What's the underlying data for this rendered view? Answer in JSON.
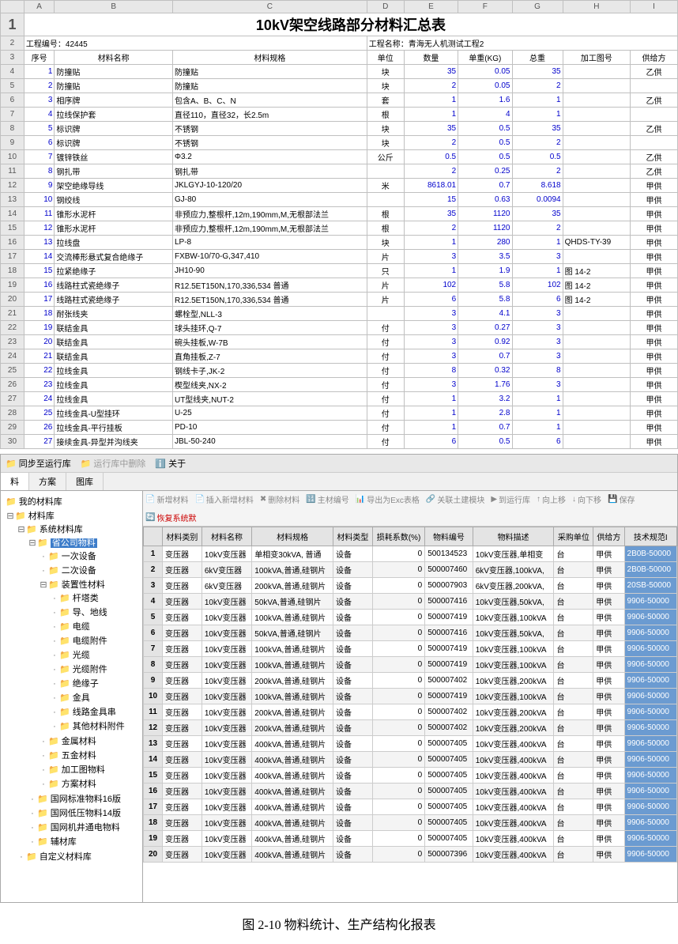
{
  "sheet": {
    "title": "10kV架空线路部分材料汇总表",
    "columns": [
      "A",
      "B",
      "C",
      "D",
      "E",
      "F",
      "G",
      "H",
      "I"
    ],
    "project_no_label": "工程编号：",
    "project_no": "42445",
    "project_name_label": "工程名称：",
    "project_name": "青海无人机测试工程2",
    "headers": [
      "序号",
      "材料名称",
      "材料规格",
      "单位",
      "数量",
      "单重(KG)",
      "总重",
      "加工图号",
      "供给方"
    ],
    "rows": [
      {
        "n": 1,
        "name": "防撞贴",
        "spec": "防撞贴",
        "unit": "块",
        "qty": "35",
        "uw": "0.05",
        "tw": "35",
        "fig": "",
        "sup": "乙供"
      },
      {
        "n": 2,
        "name": "防撞贴",
        "spec": "防撞贴",
        "unit": "块",
        "qty": "2",
        "uw": "0.05",
        "tw": "2",
        "fig": "",
        "sup": ""
      },
      {
        "n": 3,
        "name": "相序牌",
        "spec": "包含A、B、C、N",
        "unit": "套",
        "qty": "1",
        "uw": "1.6",
        "tw": "1",
        "fig": "",
        "sup": "乙供"
      },
      {
        "n": 4,
        "name": "拉线保护套",
        "spec": "直径110，直径32，长2.5m",
        "unit": "根",
        "qty": "1",
        "uw": "4",
        "tw": "1",
        "fig": "",
        "sup": ""
      },
      {
        "n": 5,
        "name": "标识牌",
        "spec": "不锈钢",
        "unit": "块",
        "qty": "35",
        "uw": "0.5",
        "tw": "35",
        "fig": "",
        "sup": "乙供"
      },
      {
        "n": 6,
        "name": "标识牌",
        "spec": "不锈钢",
        "unit": "块",
        "qty": "2",
        "uw": "0.5",
        "tw": "2",
        "fig": "",
        "sup": ""
      },
      {
        "n": 7,
        "name": "镀锌铁丝",
        "spec": "Φ3.2",
        "unit": "公斤",
        "qty": "0.5",
        "uw": "0.5",
        "tw": "0.5",
        "fig": "",
        "sup": "乙供"
      },
      {
        "n": 8,
        "name": "钢扎带",
        "spec": "钢扎带",
        "unit": "",
        "qty": "2",
        "uw": "0.25",
        "tw": "2",
        "fig": "",
        "sup": "乙供"
      },
      {
        "n": 9,
        "name": "架空绝缘导线",
        "spec": "JKLGYJ-10-120/20",
        "unit": "米",
        "qty": "8618.01",
        "uw": "0.7",
        "tw": "8.618",
        "fig": "",
        "sup": "甲供"
      },
      {
        "n": 10,
        "name": "钢绞线",
        "spec": "GJ-80",
        "unit": "",
        "qty": "15",
        "uw": "0.63",
        "tw": "0.0094",
        "fig": "",
        "sup": "甲供"
      },
      {
        "n": 11,
        "name": "锥形水泥杆",
        "spec": "非预应力,整根杆,12m,190mm,M,无根部法兰",
        "unit": "根",
        "qty": "35",
        "uw": "1120",
        "tw": "35",
        "fig": "",
        "sup": "甲供"
      },
      {
        "n": 12,
        "name": "锥形水泥杆",
        "spec": "非预应力,整根杆,12m,190mm,M,无根部法兰",
        "unit": "根",
        "qty": "2",
        "uw": "1120",
        "tw": "2",
        "fig": "",
        "sup": "甲供"
      },
      {
        "n": 13,
        "name": "拉线盘",
        "spec": "LP-8",
        "unit": "块",
        "qty": "1",
        "uw": "280",
        "tw": "1",
        "fig": "QHDS-TY-39",
        "sup": "甲供"
      },
      {
        "n": 14,
        "name": "交流棒形悬式复合绝缘子",
        "spec": "FXBW-10/70-G,347,410",
        "unit": "片",
        "qty": "3",
        "uw": "3.5",
        "tw": "3",
        "fig": "",
        "sup": "甲供"
      },
      {
        "n": 15,
        "name": "拉紧绝缘子",
        "spec": "JH10-90",
        "unit": "只",
        "qty": "1",
        "uw": "1.9",
        "tw": "1",
        "fig": "图 14-2",
        "sup": "甲供"
      },
      {
        "n": 16,
        "name": "线路柱式瓷绝缘子",
        "spec": "R12.5ET150N,170,336,534 普通",
        "unit": "片",
        "qty": "102",
        "uw": "5.8",
        "tw": "102",
        "fig": "图 14-2",
        "sup": "甲供"
      },
      {
        "n": 17,
        "name": "线路柱式瓷绝缘子",
        "spec": "R12.5ET150N,170,336,534 普通",
        "unit": "片",
        "qty": "6",
        "uw": "5.8",
        "tw": "6",
        "fig": "图 14-2",
        "sup": "甲供"
      },
      {
        "n": 18,
        "name": "耐张线夹",
        "spec": "螺栓型,NLL-3",
        "unit": "",
        "qty": "3",
        "uw": "4.1",
        "tw": "3",
        "fig": "",
        "sup": "甲供"
      },
      {
        "n": 19,
        "name": "联结金具",
        "spec": "球头挂环,Q-7",
        "unit": "付",
        "qty": "3",
        "uw": "0.27",
        "tw": "3",
        "fig": "",
        "sup": "甲供"
      },
      {
        "n": 20,
        "name": "联结金具",
        "spec": "碗头挂板,W-7B",
        "unit": "付",
        "qty": "3",
        "uw": "0.92",
        "tw": "3",
        "fig": "",
        "sup": "甲供"
      },
      {
        "n": 21,
        "name": "联结金具",
        "spec": "直角挂板,Z-7",
        "unit": "付",
        "qty": "3",
        "uw": "0.7",
        "tw": "3",
        "fig": "",
        "sup": "甲供"
      },
      {
        "n": 22,
        "name": "拉线金具",
        "spec": "钢线卡子,JK-2",
        "unit": "付",
        "qty": "8",
        "uw": "0.32",
        "tw": "8",
        "fig": "",
        "sup": "甲供"
      },
      {
        "n": 23,
        "name": "拉线金具",
        "spec": "楔型线夹,NX-2",
        "unit": "付",
        "qty": "3",
        "uw": "1.76",
        "tw": "3",
        "fig": "",
        "sup": "甲供"
      },
      {
        "n": 24,
        "name": "拉线金具",
        "spec": "UT型线夹,NUT-2",
        "unit": "付",
        "qty": "1",
        "uw": "3.2",
        "tw": "1",
        "fig": "",
        "sup": "甲供"
      },
      {
        "n": 25,
        "name": "拉线金具-U型挂环",
        "spec": "U-25",
        "unit": "付",
        "qty": "1",
        "uw": "2.8",
        "tw": "1",
        "fig": "",
        "sup": "甲供"
      },
      {
        "n": 26,
        "name": "拉线金具-平行挂板",
        "spec": "PD-10",
        "unit": "付",
        "qty": "1",
        "uw": "0.7",
        "tw": "1",
        "fig": "",
        "sup": "甲供"
      },
      {
        "n": 27,
        "name": "接续金具-异型并沟线夹",
        "spec": "JBL-50-240",
        "unit": "付",
        "qty": "6",
        "uw": "0.5",
        "tw": "6",
        "fig": "",
        "sup": "甲供"
      }
    ]
  },
  "mid": {
    "sync_label": "同步至运行库",
    "run_label": "运行库中删除",
    "about_label": "关于",
    "tabs": [
      "料",
      "方案",
      "图库"
    ]
  },
  "tree": {
    "root": "我的材料库",
    "lib": "材料库",
    "nodes": [
      {
        "label": "系统材料库",
        "children": [
          {
            "label": "省公司物料",
            "selected": true,
            "children": [
              {
                "label": "一次设备"
              },
              {
                "label": "二次设备"
              },
              {
                "label": "装置性材料",
                "children": [
                  {
                    "label": "杆塔类"
                  },
                  {
                    "label": "导、地线"
                  },
                  {
                    "label": "电缆"
                  },
                  {
                    "label": "电缆附件"
                  },
                  {
                    "label": "光缆"
                  },
                  {
                    "label": "光缆附件"
                  },
                  {
                    "label": "绝缘子"
                  },
                  {
                    "label": "金具"
                  },
                  {
                    "label": "线路金具串"
                  },
                  {
                    "label": "其他材料附件"
                  }
                ]
              },
              {
                "label": "金属材料"
              },
              {
                "label": "五金材料"
              },
              {
                "label": "加工图物料"
              },
              {
                "label": "方案材料"
              }
            ]
          },
          {
            "label": "国网标准物料16版"
          },
          {
            "label": "国网低压物料14版"
          },
          {
            "label": "国网机井通电物料"
          },
          {
            "label": "辅材库"
          }
        ]
      },
      {
        "label": "自定义材料库"
      }
    ]
  },
  "gridToolbar": {
    "items": [
      "新增材料",
      "插入新增材料",
      "删除材料",
      "主材编号",
      "导出为Exc表格",
      "关联土建模块",
      "到运行库",
      "向上移",
      "向下移",
      "保存"
    ],
    "restore": "恢复系统默"
  },
  "grid": {
    "headers": [
      "",
      "材料类别",
      "材料名称",
      "材料规格",
      "材料类型",
      "损耗系数(%)",
      "物料编号",
      "物料描述",
      "采购单位",
      "供给方",
      "技术规范I"
    ],
    "rows": [
      {
        "n": 1,
        "cat": "变压器",
        "name": "10kV变压器",
        "spec": "单相变30kVA, 普通",
        "type": "设备",
        "loss": "0",
        "code": "500134523",
        "desc": "10kV变压器,单相变",
        "pu": "台",
        "sup": "甲供",
        "tech": "2B0B-50000"
      },
      {
        "n": 2,
        "cat": "变压器",
        "name": "6kV变压器",
        "spec": "100kVA,普通,硅钢片",
        "type": "设备",
        "loss": "0",
        "code": "500007460",
        "desc": "6kV变压器,100kVA,",
        "pu": "台",
        "sup": "甲供",
        "tech": "2B0B-50000"
      },
      {
        "n": 3,
        "cat": "变压器",
        "name": "6kV变压器",
        "spec": "200kVA,普通,硅钢片",
        "type": "设备",
        "loss": "0",
        "code": "500007903",
        "desc": "6kV变压器,200kVA,",
        "pu": "台",
        "sup": "甲供",
        "tech": "20SB-50000"
      },
      {
        "n": 4,
        "cat": "变压器",
        "name": "10kV变压器",
        "spec": "50kVA,普通,硅钢片",
        "type": "设备",
        "loss": "0",
        "code": "500007416",
        "desc": "10kV变压器,50kVA,",
        "pu": "台",
        "sup": "甲供",
        "tech": "9906-50000"
      },
      {
        "n": 5,
        "cat": "变压器",
        "name": "10kV变压器",
        "spec": "100kVA,普通,硅钢片",
        "type": "设备",
        "loss": "0",
        "code": "500007419",
        "desc": "10kV变压器,100kVA",
        "pu": "台",
        "sup": "甲供",
        "tech": "9906-50000"
      },
      {
        "n": 6,
        "cat": "变压器",
        "name": "10kV变压器",
        "spec": "50kVA,普通,硅钢片",
        "type": "设备",
        "loss": "0",
        "code": "500007416",
        "desc": "10kV变压器,50kVA,",
        "pu": "台",
        "sup": "甲供",
        "tech": "9906-50000"
      },
      {
        "n": 7,
        "cat": "变压器",
        "name": "10kV变压器",
        "spec": "100kVA,普通,硅钢片",
        "type": "设备",
        "loss": "0",
        "code": "500007419",
        "desc": "10kV变压器,100kVA",
        "pu": "台",
        "sup": "甲供",
        "tech": "9906-50000"
      },
      {
        "n": 8,
        "cat": "变压器",
        "name": "10kV变压器",
        "spec": "100kVA,普通,硅钢片",
        "type": "设备",
        "loss": "0",
        "code": "500007419",
        "desc": "10kV变压器,100kVA",
        "pu": "台",
        "sup": "甲供",
        "tech": "9906-50000"
      },
      {
        "n": 9,
        "cat": "变压器",
        "name": "10kV变压器",
        "spec": "200kVA,普通,硅钢片",
        "type": "设备",
        "loss": "0",
        "code": "500007402",
        "desc": "10kV变压器,200kVA",
        "pu": "台",
        "sup": "甲供",
        "tech": "9906-50000"
      },
      {
        "n": 10,
        "cat": "变压器",
        "name": "10kV变压器",
        "spec": "100kVA,普通,硅钢片",
        "type": "设备",
        "loss": "0",
        "code": "500007419",
        "desc": "10kV变压器,100kVA",
        "pu": "台",
        "sup": "甲供",
        "tech": "9906-50000"
      },
      {
        "n": 11,
        "cat": "变压器",
        "name": "10kV变压器",
        "spec": "200kVA,普通,硅钢片",
        "type": "设备",
        "loss": "0",
        "code": "500007402",
        "desc": "10kV变压器,200kVA",
        "pu": "台",
        "sup": "甲供",
        "tech": "9906-50000"
      },
      {
        "n": 12,
        "cat": "变压器",
        "name": "10kV变压器",
        "spec": "200kVA,普通,硅钢片",
        "type": "设备",
        "loss": "0",
        "code": "500007402",
        "desc": "10kV变压器,200kVA",
        "pu": "台",
        "sup": "甲供",
        "tech": "9906-50000"
      },
      {
        "n": 13,
        "cat": "变压器",
        "name": "10kV变压器",
        "spec": "400kVA,普通,硅钢片",
        "type": "设备",
        "loss": "0",
        "code": "500007405",
        "desc": "10kV变压器,400kVA",
        "pu": "台",
        "sup": "甲供",
        "tech": "9906-50000"
      },
      {
        "n": 14,
        "cat": "变压器",
        "name": "10kV变压器",
        "spec": "400kVA,普通,硅钢片",
        "type": "设备",
        "loss": "0",
        "code": "500007405",
        "desc": "10kV变压器,400kVA",
        "pu": "台",
        "sup": "甲供",
        "tech": "9906-50000"
      },
      {
        "n": 15,
        "cat": "变压器",
        "name": "10kV变压器",
        "spec": "400kVA,普通,硅钢片",
        "type": "设备",
        "loss": "0",
        "code": "500007405",
        "desc": "10kV变压器,400kVA",
        "pu": "台",
        "sup": "甲供",
        "tech": "9906-50000"
      },
      {
        "n": 16,
        "cat": "变压器",
        "name": "10kV变压器",
        "spec": "400kVA,普通,硅钢片",
        "type": "设备",
        "loss": "0",
        "code": "500007405",
        "desc": "10kV变压器,400kVA",
        "pu": "台",
        "sup": "甲供",
        "tech": "9906-50000"
      },
      {
        "n": 17,
        "cat": "变压器",
        "name": "10kV变压器",
        "spec": "400kVA,普通,硅钢片",
        "type": "设备",
        "loss": "0",
        "code": "500007405",
        "desc": "10kV变压器,400kVA",
        "pu": "台",
        "sup": "甲供",
        "tech": "9906-50000"
      },
      {
        "n": 18,
        "cat": "变压器",
        "name": "10kV变压器",
        "spec": "400kVA,普通,硅钢片",
        "type": "设备",
        "loss": "0",
        "code": "500007405",
        "desc": "10kV变压器,400kVA",
        "pu": "台",
        "sup": "甲供",
        "tech": "9906-50000"
      },
      {
        "n": 19,
        "cat": "变压器",
        "name": "10kV变压器",
        "spec": "400kVA,普通,硅钢片",
        "type": "设备",
        "loss": "0",
        "code": "500007405",
        "desc": "10kV变压器,400kVA",
        "pu": "台",
        "sup": "甲供",
        "tech": "9906-50000"
      },
      {
        "n": 20,
        "cat": "变压器",
        "name": "10kV变压器",
        "spec": "400kVA,普通,硅钢片",
        "type": "设备",
        "loss": "0",
        "code": "500007396",
        "desc": "10kV变压器,400kVA",
        "pu": "台",
        "sup": "甲供",
        "tech": "9906-50000"
      }
    ]
  },
  "caption": "图 2-10 物料统计、生产结构化报表"
}
